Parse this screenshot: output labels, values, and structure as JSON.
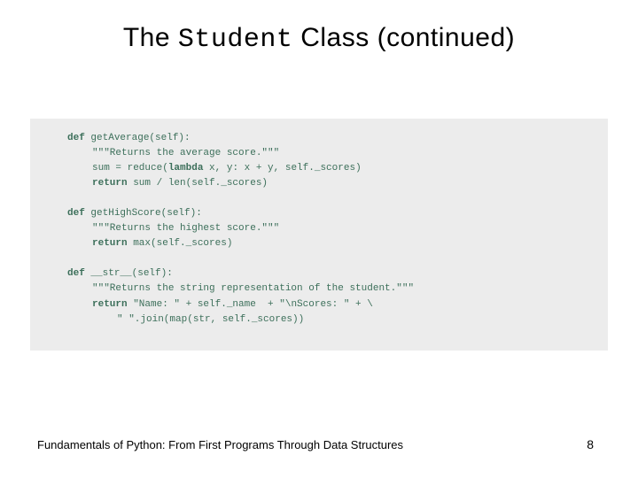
{
  "title": {
    "part1": "The ",
    "mono": "Student",
    "part2": " Class (continued)"
  },
  "code": {
    "l1_kw": "def",
    "l1_rest": " getAverage(self):",
    "l2": "\"\"\"Returns the average score.\"\"\"",
    "l3a": "sum = reduce(",
    "l3_kw": "lambda",
    "l3b": " x, y: x + y, self._scores)",
    "l4_kw": "return",
    "l4_rest": " sum / len(self._scores)",
    "l5_kw": "def",
    "l5_rest": " getHighScore(self):",
    "l6": "\"\"\"Returns the highest score.\"\"\"",
    "l7_kw": "return",
    "l7_rest": " max(self._scores)",
    "l8_kw": "def",
    "l8_rest": " __str__(self):",
    "l9": "\"\"\"Returns the string representation of the student.\"\"\"",
    "l10_kw": "return",
    "l10_rest": " \"Name: \" + self._name  + \"\\nScores: \" + \\",
    "l11": "\" \".join(map(str, self._scores))"
  },
  "footer": {
    "text": "Fundamentals of Python: From First Programs Through Data Structures",
    "page": "8"
  }
}
